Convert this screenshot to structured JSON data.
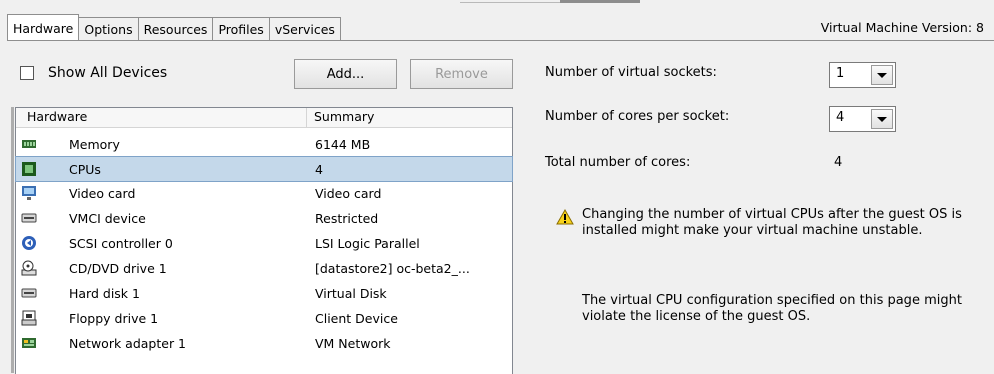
{
  "tabs": [
    "Hardware",
    "Options",
    "Resources",
    "Profiles",
    "vServices"
  ],
  "vm_version_label": "Virtual Machine Version: 8",
  "left": {
    "show_all_label": "Show All Devices",
    "add_label": "Add...",
    "remove_label": "Remove",
    "col_hardware": "Hardware",
    "col_summary": "Summary",
    "rows": [
      {
        "name": "Memory",
        "summary": "6144 MB",
        "icon": "memory-icon"
      },
      {
        "name": "CPUs",
        "summary": "4",
        "icon": "cpu-icon",
        "selected": true
      },
      {
        "name": "Video card",
        "summary": "Video card",
        "icon": "monitor-icon"
      },
      {
        "name": "VMCI device",
        "summary": "Restricted",
        "icon": "device-icon"
      },
      {
        "name": "SCSI controller 0",
        "summary": "LSI Logic Parallel",
        "icon": "scsi-icon"
      },
      {
        "name": "CD/DVD drive 1",
        "summary": "[datastore2] oc-beta2_...",
        "icon": "cd-drive-icon"
      },
      {
        "name": "Hard disk 1",
        "summary": "Virtual Disk",
        "icon": "hard-disk-icon"
      },
      {
        "name": "Floppy drive 1",
        "summary": "Client Device",
        "icon": "floppy-icon"
      },
      {
        "name": "Network adapter 1",
        "summary": "VM Network",
        "icon": "network-icon"
      }
    ]
  },
  "right": {
    "sockets_label": "Number of virtual sockets:",
    "sockets_value": "1",
    "cores_label": "Number of cores per socket:",
    "cores_value": "4",
    "total_label": "Total number of cores:",
    "total_value": "4",
    "warning_text": "Changing the number of virtual CPUs after the guest OS is installed might make your virtual machine unstable.",
    "license_text": "The virtual CPU configuration specified on this page might violate the license of the guest OS."
  }
}
